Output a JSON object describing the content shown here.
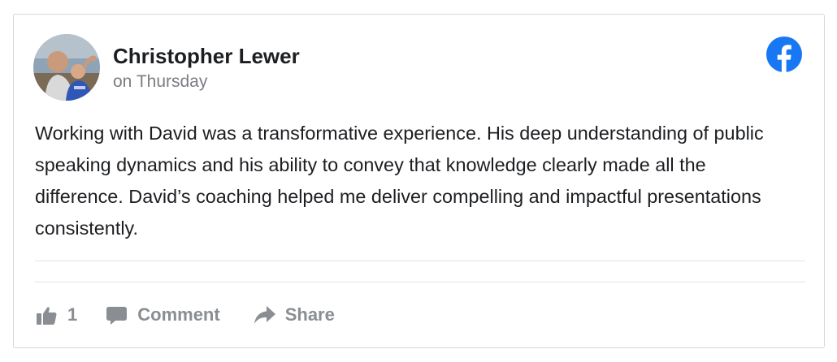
{
  "post": {
    "author": "Christopher Lewer",
    "timestamp": "on Thursday",
    "text": "Working with David was a transformative experience. His deep understanding of public speaking dynamics and his ability to convey that knowledge clearly made all the difference. David’s coaching helped me deliver compelling and impactful presentations consistently.",
    "platform_icon": "facebook-icon",
    "avatar_icon": "avatar-photo"
  },
  "actions": {
    "like_count": "1",
    "like_icon": "thumbs-up-icon",
    "comment_label": "Comment",
    "comment_icon": "speech-bubble-icon",
    "share_label": "Share",
    "share_icon": "share-arrow-icon"
  },
  "colors": {
    "facebook_blue": "#1877f2",
    "action_gray": "#8a8d91",
    "text_dark": "#1c1e21",
    "muted_text": "#7a7d82",
    "divider": "#e3e3e3",
    "border": "#d7d7d7"
  }
}
